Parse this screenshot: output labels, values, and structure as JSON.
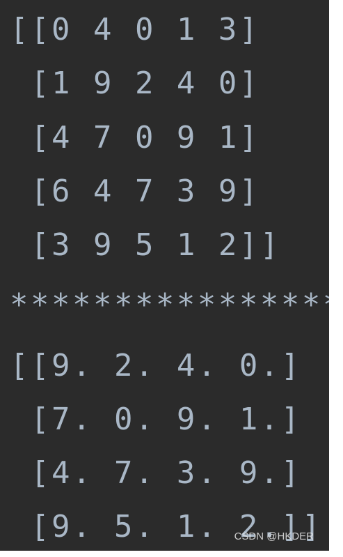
{
  "console": {
    "lines": [
      "[[0 4 0 1 3]",
      " [1 9 2 4 0]",
      " [4 7 0 9 1]",
      " [6 4 7 3 9]",
      " [3 9 5 1 2]]",
      "****************",
      "[[9. 2. 4. 0.]",
      " [7. 0. 9. 1.]",
      " [4. 7. 3. 9.]",
      " [9. 5. 1. 2.]]"
    ],
    "text_color": "#a9b7c6",
    "background": "#2b2b2b"
  },
  "watermark": {
    "text": "CSDN @HKDER"
  }
}
